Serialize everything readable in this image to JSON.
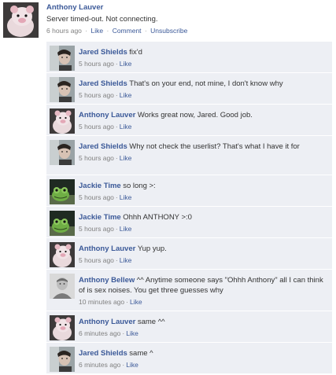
{
  "post": {
    "author": "Anthony Lauver",
    "text": "Server timed-out. Not connecting.",
    "time": "6 hours ago",
    "sep": "·",
    "like": "Like",
    "comment": "Comment",
    "unsubscribe": "Unsubscribe"
  },
  "comments": [
    {
      "author": "Jared Shields",
      "text": "fix'd",
      "time": "5 hours ago",
      "like": "Like",
      "avatar": "jared"
    },
    {
      "author": "Jared Shields",
      "text": "That's on your end, not mine, I don't know why",
      "time": "5 hours ago",
      "like": "Like",
      "avatar": "jared"
    },
    {
      "author": "Anthony Lauver",
      "text": "Works great now, Jared. Good job.",
      "time": "5 hours ago",
      "like": "Like",
      "avatar": "pig"
    },
    {
      "author": "Jared Shields",
      "text": "Why not check the userlist? That's what I have it for",
      "time": "5 hours ago",
      "like": "Like",
      "avatar": "jared"
    },
    {
      "author": "Jackie Time",
      "text": "so long >:",
      "time": "5 hours ago",
      "like": "Like",
      "avatar": "jackie"
    },
    {
      "author": "Jackie Time",
      "text": "Ohhh ANTHONY >:0",
      "time": "5 hours ago",
      "like": "Like",
      "avatar": "jackie"
    },
    {
      "author": "Anthony Lauver",
      "text": "Yup yup.",
      "time": "5 hours ago",
      "like": "Like",
      "avatar": "pig"
    },
    {
      "author": "Anthony Bellew",
      "text": "^^ Anytime someone says \"Ohhh Anthony\" all I can think of is sex noises. You get three guesses why",
      "time": "10 minutes ago",
      "like": "Like",
      "avatar": "bellew"
    },
    {
      "author": "Anthony Lauver",
      "text": "same ^^",
      "time": "6 minutes ago",
      "like": "Like",
      "avatar": "pig"
    },
    {
      "author": "Jared Shields",
      "text": "same ^",
      "time": "6 minutes ago",
      "like": "Like",
      "avatar": "jared"
    }
  ],
  "colors": {
    "link": "#3b5998",
    "comment_bg": "#edeff4",
    "meta": "#808080"
  }
}
